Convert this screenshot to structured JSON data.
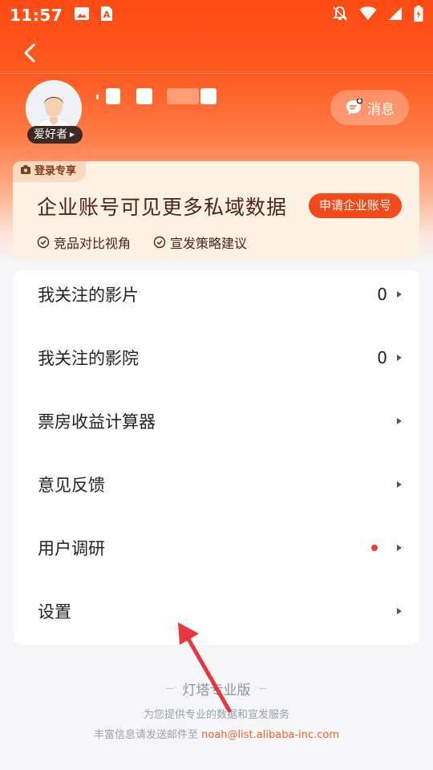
{
  "status_bar": {
    "time": "11:57",
    "left_icons": [
      "image-icon",
      "text-app-icon"
    ],
    "right_icons": [
      "bell-off-icon",
      "wifi-icon",
      "signal-icon",
      "battery-charging-icon"
    ]
  },
  "nav": {
    "back_icon": "chevron-left-icon"
  },
  "profile": {
    "role_badge": "爱好者",
    "message_button": "消息"
  },
  "promo": {
    "tag": "登录专享",
    "title": "企业账号可见更多私域数据",
    "apply_button": "申请企业账号",
    "features": [
      "竞品对比视角",
      "宣发策略建议"
    ]
  },
  "menu": {
    "items": [
      {
        "label": "我关注的影片",
        "count": "0"
      },
      {
        "label": "我关注的影院",
        "count": "0"
      },
      {
        "label": "票房收益计算器"
      },
      {
        "label": "意见反馈"
      },
      {
        "label": "用户调研",
        "has_dot": true
      },
      {
        "label": "设置"
      }
    ]
  },
  "footer": {
    "brand": "灯塔专业版",
    "tagline": "为您提供专业的数据和宣发服务",
    "contact_prefix": "丰富信息请发送邮件至",
    "email": "noah@list.alibaba-inc.com"
  },
  "colors": {
    "brand_orange": "#fe4a14",
    "apply_button": "#f24a1a",
    "red_dot": "#f23a3a",
    "annotation_arrow": "#e8363f"
  }
}
